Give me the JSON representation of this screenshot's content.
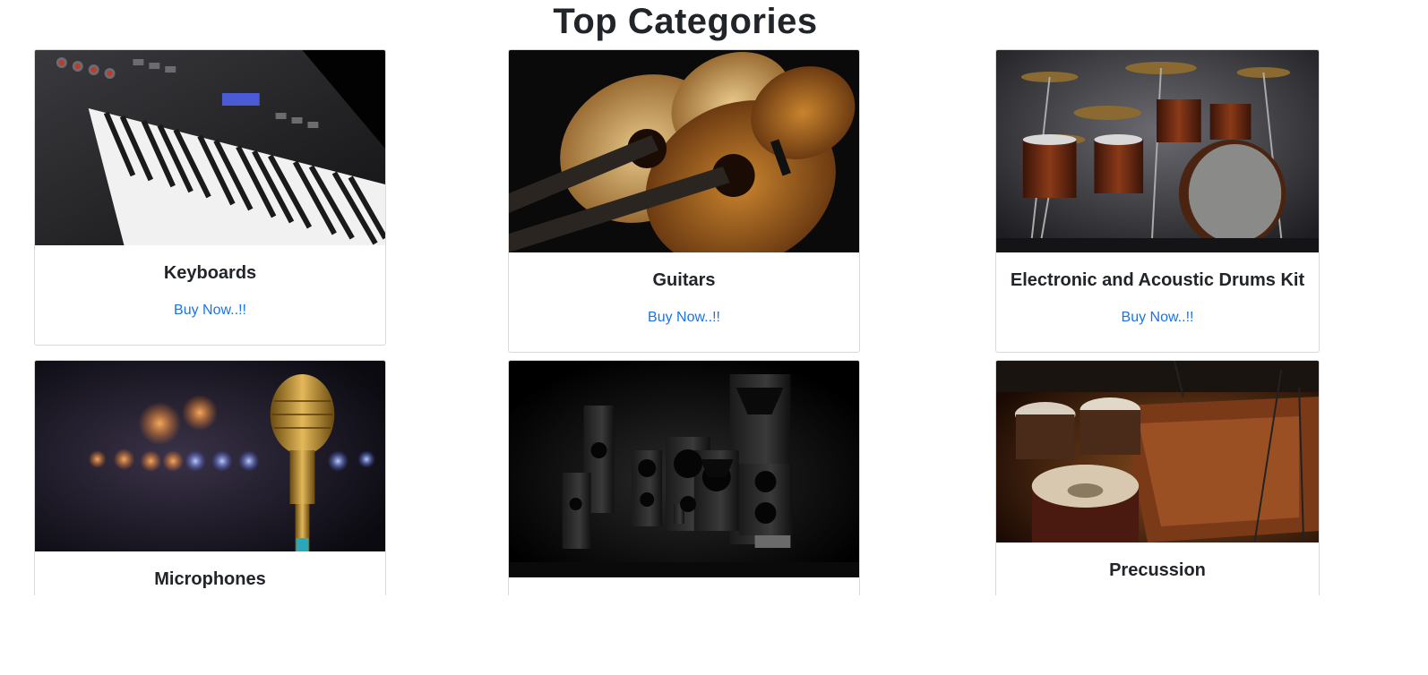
{
  "page": {
    "title": "Top Categories"
  },
  "categories": [
    {
      "name": "Keyboards",
      "link": "Buy Now..!!",
      "image": "keyboard-image"
    },
    {
      "name": "Guitars",
      "link": "Buy Now..!!",
      "image": "guitar-image"
    },
    {
      "name": "Electronic and Acoustic Drums Kit",
      "link": "Buy Now..!!",
      "image": "drums-image"
    },
    {
      "name": "Microphones",
      "link": "",
      "image": "microphone-image"
    },
    {
      "name": "",
      "link": "",
      "image": "speakers-image"
    },
    {
      "name": "Precussion",
      "link": "",
      "image": "percussion-image"
    }
  ],
  "colors": {
    "link": "#1a73e8",
    "border": "#d9d9d9",
    "text": "#212529"
  }
}
